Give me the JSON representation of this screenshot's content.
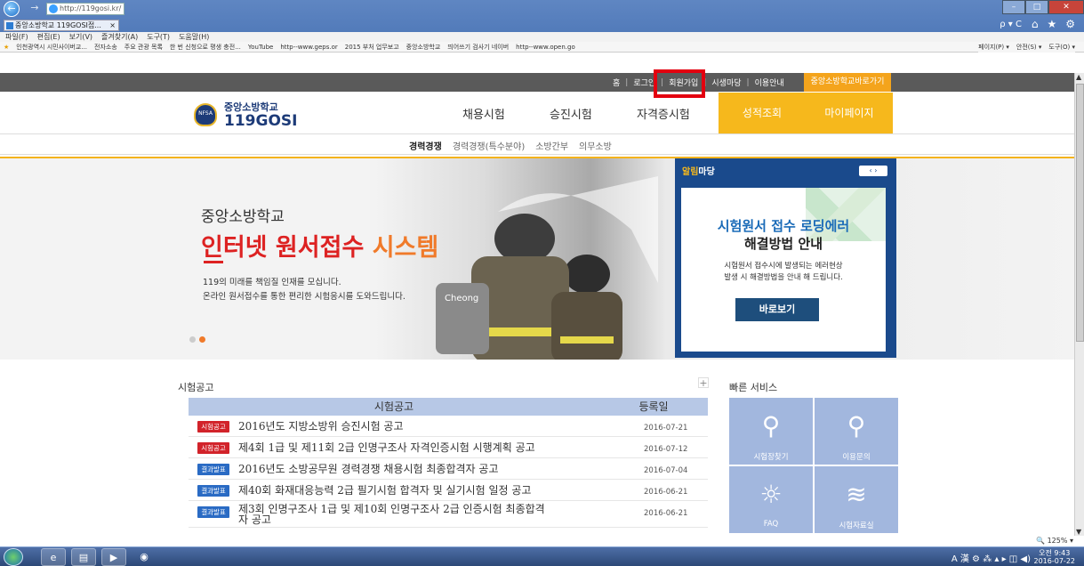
{
  "browser": {
    "address": "http://119gosi.kr/",
    "tab_title": "중앙소방학교 119GOSI접...",
    "tab_close": "×",
    "menu": [
      "파일(F)",
      "편집(E)",
      "보기(V)",
      "즐겨찾기(A)",
      "도구(T)",
      "도움말(H)"
    ],
    "favorites": [
      "인천광역시 시민사이버교...",
      "전자소송",
      "주요 관광 목록",
      "한 번 신청으로 평생 충전...",
      "YouTube",
      "http--www.geps.or",
      "2015 부처 업무보고",
      "중앙소방학교",
      "띄어쓰기 검사기 네이버",
      "http--www.open.go"
    ],
    "commands": [
      "페이지(P) ▾",
      "안전(S) ▾",
      "도구(O) ▾"
    ],
    "search_glyph": "ρ ▾ C",
    "zoom": "125%"
  },
  "util_bar": {
    "links": [
      "홈",
      "로그인",
      "회원가입",
      "시생마당",
      "이용안내"
    ],
    "cta": "중앙소방학교바로가기"
  },
  "header": {
    "logo_line1": "중앙소방학교",
    "logo_line2": "119GOSI",
    "emblem_text": "NFSA",
    "gnb": [
      "채용시험",
      "승진시험",
      "자격증시험"
    ],
    "gnb_yellow": [
      "성적조회",
      "마이페이지"
    ]
  },
  "subnav": {
    "items": [
      "경력경쟁",
      "경력경쟁(특수분야)",
      "소방간부",
      "의무소방"
    ]
  },
  "hero": {
    "sub": "중앙소방학교",
    "title_main": "인터넷 원서접수 ",
    "title_hl": "시스템",
    "desc1": "119의 미래를 책임질 인재를 모십니다.",
    "desc2": "온라인 원서접수를 통한 편리한 시험응시를 도와드립니다."
  },
  "notice_panel": {
    "head_a": "알림",
    "head_b": "마당",
    "arrows": "‹ ›",
    "title1": "시험원서 접수 로딩에러",
    "title2": "해결방법 안내",
    "desc1": "시험원서 접수시에 발생되는 에러현상",
    "desc2": "발생 시 해결방법을 안내 해 드립니다.",
    "button": "바로보기"
  },
  "board": {
    "title": "시험공고",
    "plus": "+",
    "col_title": "시험공고",
    "col_date": "등록일",
    "rows": [
      {
        "tag": "시험공고",
        "tag_color": "#d2232a",
        "text": "2016년도 지방소방위 승진시험 공고",
        "date": "2016-07-21"
      },
      {
        "tag": "시험공고",
        "tag_color": "#d2232a",
        "text": "제4회 1급 및 제11회 2급 인명구조사 자격인증시험 시행계획 공고",
        "date": "2016-07-12"
      },
      {
        "tag": "결과발표",
        "tag_color": "#2a6bc4",
        "text": "2016년도 소방공무원 경력경쟁 채용시험 최종합격자 공고",
        "date": "2016-07-04"
      },
      {
        "tag": "결과발표",
        "tag_color": "#2a6bc4",
        "text": "제40회 화재대응능력 2급 필기시험 합격자 및 실기시험 일정 공고",
        "date": "2016-06-21"
      },
      {
        "tag": "결과발표",
        "tag_color": "#2a6bc4",
        "text": "제3회 인명구조사 1급 및 제10회 인명구조사 2급 인증시험 최종합격",
        "text2": "자 공고",
        "date": "2016-06-21"
      }
    ]
  },
  "quick": {
    "title": "빠른 서비스",
    "tiles": [
      {
        "label": "시험장찾기",
        "icon": "map-pin-icon"
      },
      {
        "label": "이용문의",
        "icon": "search-icon"
      },
      {
        "label": "FAQ",
        "icon": "lightbulb-icon"
      },
      {
        "label": "시험자료실",
        "icon": "books-icon"
      }
    ]
  },
  "taskbar": {
    "tray": "A 漢 ⚙ ⁂ ▴ ▸ ◫ ◀)",
    "time": "오전 9:43",
    "date": "2016-07-22"
  },
  "colors": {
    "accent_yellow": "#f6b81c",
    "highlight_red": "#e3000f",
    "notice_blue": "#1a4a8c"
  }
}
